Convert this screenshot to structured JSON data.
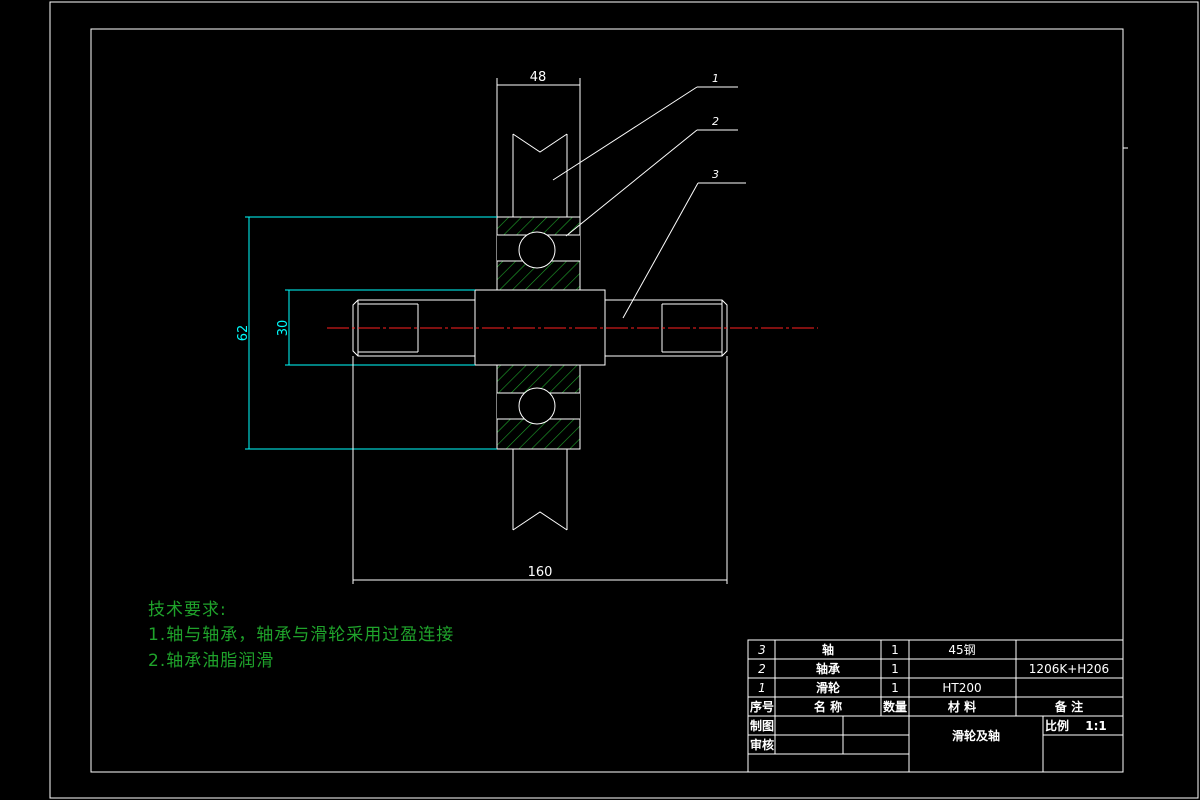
{
  "dimensions": {
    "width_top": "48",
    "outer_diameter": "62",
    "shaft_diameter": "30",
    "total_length": "160"
  },
  "callouts": [
    "1",
    "2",
    "3"
  ],
  "tech_requirements": {
    "title": "技术要求:",
    "items": [
      "1.轴与轴承，轴承与滑轮采用过盈连接",
      "2.轴承油脂润滑"
    ]
  },
  "parts_list": [
    {
      "no": "3",
      "name": "轴",
      "qty": "1",
      "material": "45钢",
      "note": ""
    },
    {
      "no": "2",
      "name": "轴承",
      "qty": "1",
      "material": "",
      "note": "1206K+H206"
    },
    {
      "no": "1",
      "name": "滑轮",
      "qty": "1",
      "material": "HT200",
      "note": ""
    }
  ],
  "parts_header": {
    "no": "序号",
    "name": "名  称",
    "qty": "数量",
    "material": "材  料",
    "note": "备  注"
  },
  "title_block": {
    "drawn_label": "制图",
    "checked_label": "审核",
    "drawing_title": "滑轮及轴",
    "scale_label": "比例",
    "scale_value": "1:1"
  },
  "colors": {
    "background": "#000000",
    "outline": "#ffffff",
    "dimension": "#00ffff",
    "hatch": "#1fa32b",
    "centerline": "#ff2020",
    "note_text": "#1fa32b"
  }
}
